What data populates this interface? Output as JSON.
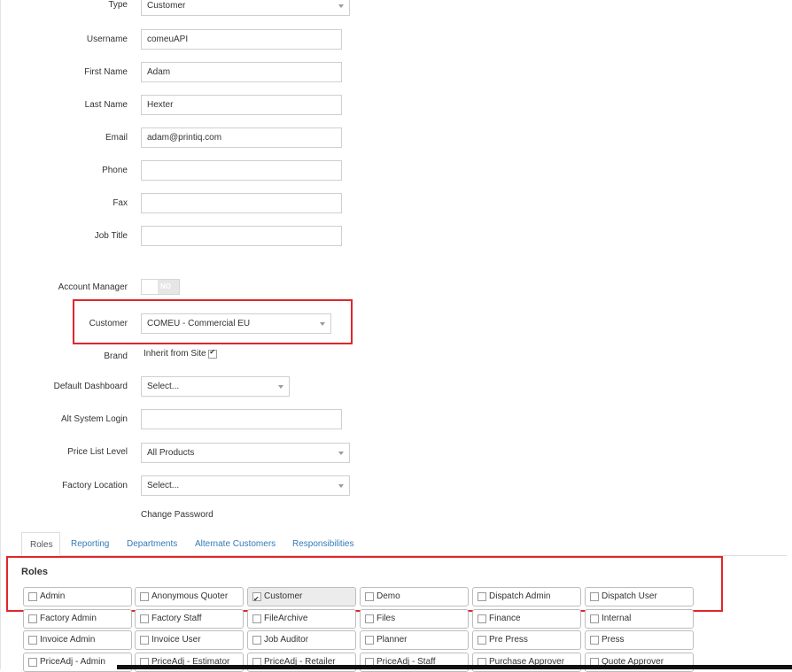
{
  "form": {
    "type": {
      "label": "Type",
      "value": "Customer"
    },
    "username": {
      "label": "Username",
      "value": "comeuAPI"
    },
    "first_name": {
      "label": "First Name",
      "value": "Adam"
    },
    "last_name": {
      "label": "Last Name",
      "value": "Hexter"
    },
    "email": {
      "label": "Email",
      "value": "adam@printiq.com"
    },
    "phone": {
      "label": "Phone",
      "value": ""
    },
    "fax": {
      "label": "Fax",
      "value": ""
    },
    "job_title": {
      "label": "Job Title",
      "value": ""
    },
    "account_manager": {
      "label": "Account Manager",
      "toggle_text": "NO"
    },
    "customer": {
      "label": "Customer",
      "value": "COMEU - Commercial EU"
    },
    "brand": {
      "label": "Brand",
      "value": "Inherit from Site",
      "checked": true
    },
    "default_dashboard": {
      "label": "Default Dashboard",
      "value": "Select..."
    },
    "alt_system_login": {
      "label": "Alt System Login",
      "value": ""
    },
    "price_list_level": {
      "label": "Price List Level",
      "value": "All Products"
    },
    "factory_location": {
      "label": "Factory Location",
      "value": "Select..."
    },
    "change_password": "Change Password"
  },
  "tabs": [
    "Roles",
    "Reporting",
    "Departments",
    "Alternate Customers",
    "Responsibilities"
  ],
  "roles_title": "Roles",
  "roles": [
    [
      "Admin",
      "Anonymous Quoter",
      "Customer",
      "Demo",
      "Dispatch Admin",
      "Dispatch User"
    ],
    [
      "Factory Admin",
      "Factory Staff",
      "FileArchive",
      "Files",
      "Finance",
      "Internal"
    ],
    [
      "Invoice Admin",
      "Invoice User",
      "Job Auditor",
      "Planner",
      "Pre Press",
      "Press"
    ],
    [
      "PriceAdj - Admin",
      "PriceAdj - Estimator",
      "PriceAdj - Retailer",
      "PriceAdj - Staff",
      "Purchase Approver",
      "Quote Approver"
    ]
  ],
  "roles_checked": [
    "Customer"
  ],
  "colors": {
    "highlight": "#e0262b",
    "tab_link": "#337ab7"
  }
}
